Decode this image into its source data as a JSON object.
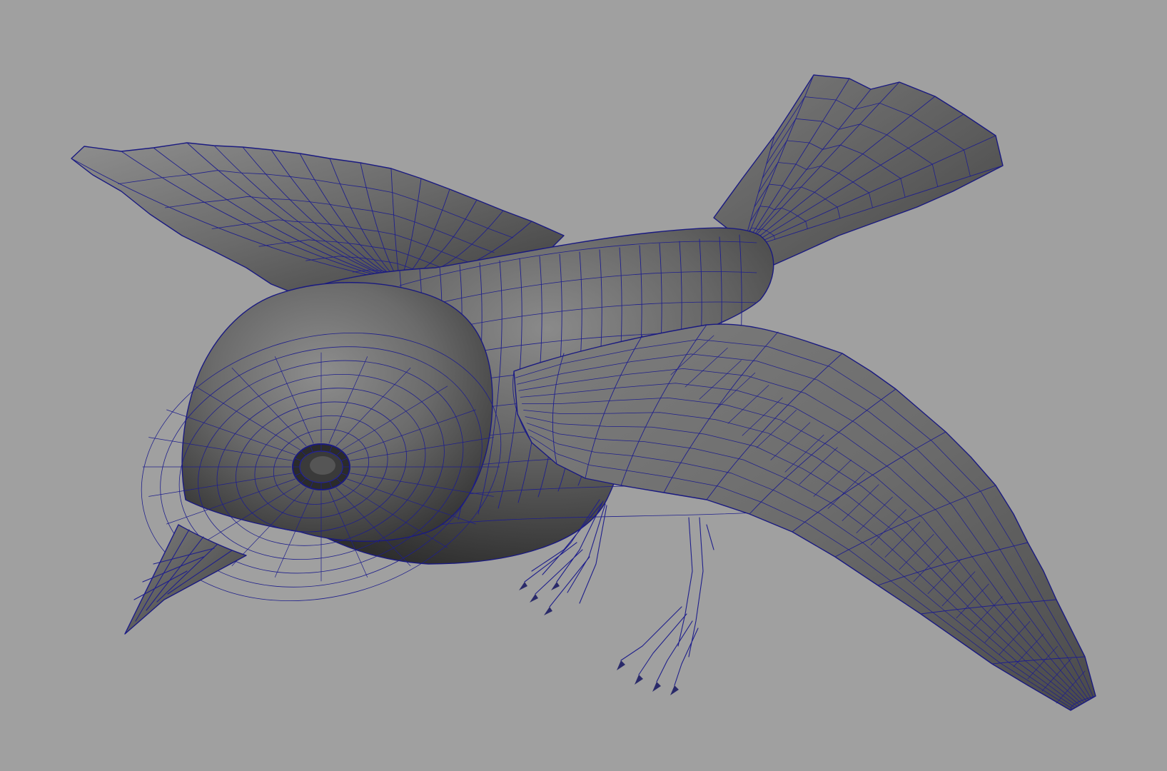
{
  "viewport": {
    "background": "#a0a0a0",
    "wireframe_color": "#1f1f8c",
    "shading": "smooth-shaded-with-wireframe"
  },
  "scene": {
    "object": "bird-model"
  }
}
